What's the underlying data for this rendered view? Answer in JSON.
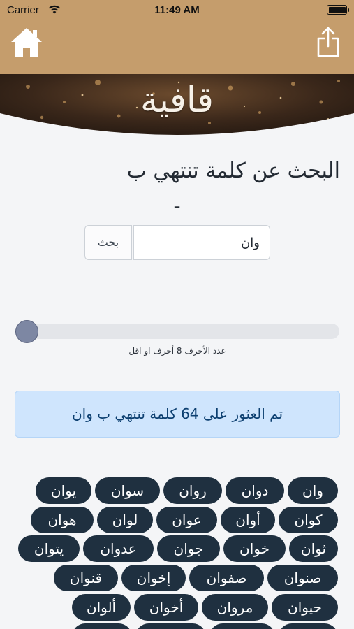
{
  "status_bar": {
    "carrier": "Carrier",
    "time": "11:49 AM"
  },
  "nav": {
    "home_icon": "home-icon",
    "share_icon": "share-icon"
  },
  "banner": {
    "logo_text": "قافية"
  },
  "page": {
    "title_line1": "البحث عن كلمة تنتهي ب",
    "title_line2": "-"
  },
  "search": {
    "input_value": "وان",
    "button_label": "بحث"
  },
  "slider": {
    "caption": "عدد الأحرف 8 أحرف او اقل",
    "value_fraction": 0
  },
  "alert": {
    "message": "تم العثور على 64 كلمة تنتهي ب وان"
  },
  "results": [
    "وان",
    "دوان",
    "روان",
    "سوان",
    "يوان",
    "كوان",
    "أوان",
    "عوان",
    "لوان",
    "هوان",
    "ثوان",
    "خوان",
    "جوان",
    "عدوان",
    "يتوان",
    "صنوان",
    "صفوان",
    "إخوان",
    "قنوان",
    "حيوان",
    "مروان",
    "أخوان",
    "ألوان"
  ],
  "colors": {
    "header": "#c59d6c",
    "chip": "#1f3040",
    "alert_bg": "#cfe5fd",
    "alert_text": "#0c3f70",
    "slider_thumb": "#7d87a3"
  }
}
